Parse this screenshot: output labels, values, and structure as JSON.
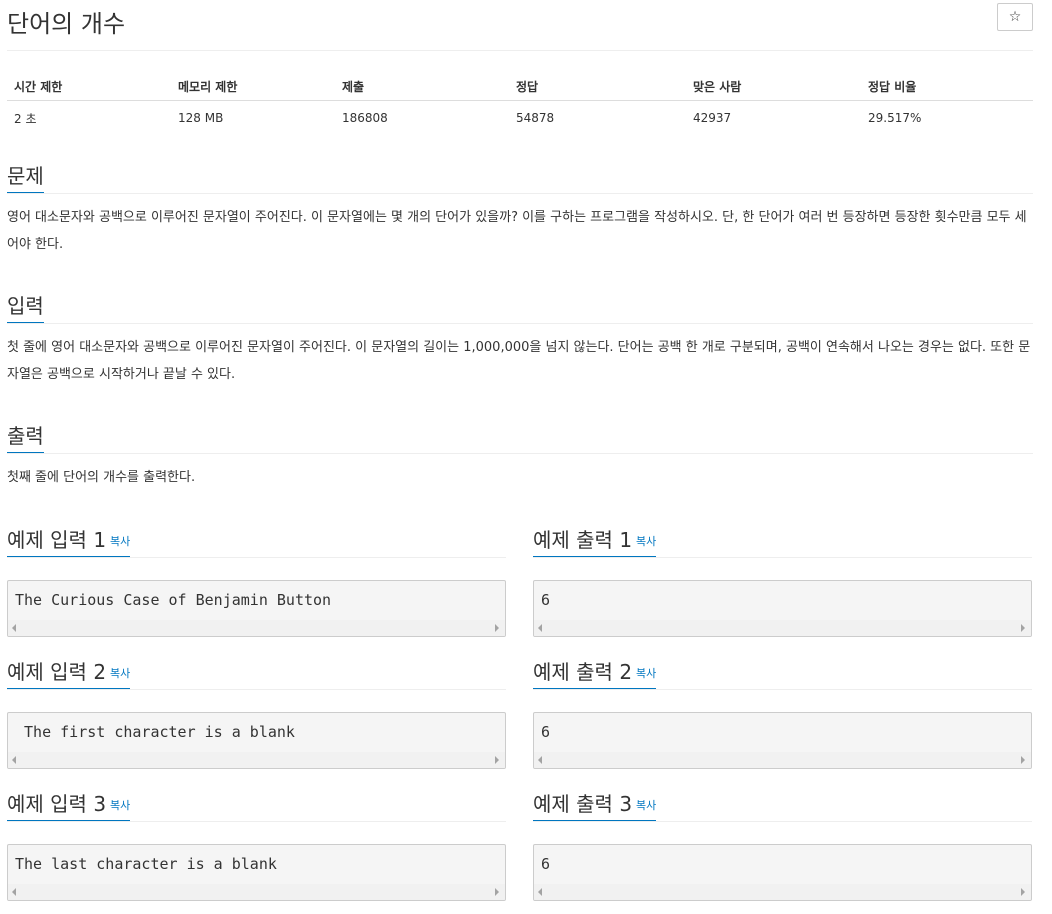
{
  "problem": {
    "title": "단어의 개수",
    "star_icon": "☆"
  },
  "info": {
    "headers": [
      "시간 제한",
      "메모리 제한",
      "제출",
      "정답",
      "맞은 사람",
      "정답 비율"
    ],
    "values": [
      "2 초",
      "128 MB",
      "186808",
      "54878",
      "42937",
      "29.517%"
    ]
  },
  "sections": {
    "description": {
      "title": "문제",
      "text": "영어 대소문자와 공백으로 이루어진 문자열이 주어진다. 이 문자열에는 몇 개의 단어가 있을까? 이를 구하는 프로그램을 작성하시오. 단, 한 단어가 여러 번 등장하면 등장한 횟수만큼 모두 세어야 한다."
    },
    "input": {
      "title": "입력",
      "text": "첫 줄에 영어 대소문자와 공백으로 이루어진 문자열이 주어진다. 이 문자열의 길이는 1,000,000을 넘지 않는다. 단어는 공백 한 개로 구분되며, 공백이 연속해서 나오는 경우는 없다. 또한 문자열은 공백으로 시작하거나 끝날 수 있다."
    },
    "output": {
      "title": "출력",
      "text": "첫째 줄에 단어의 개수를 출력한다."
    }
  },
  "samples": {
    "copy_label": "복사",
    "input_1": {
      "title": "예제 입력 1",
      "text": "The Curious Case of Benjamin Button"
    },
    "output_1": {
      "title": "예제 출력 1",
      "text": "6"
    },
    "input_2": {
      "title": "예제 입력 2",
      "text": " The first character is a blank"
    },
    "output_2": {
      "title": "예제 출력 2",
      "text": "6"
    },
    "input_3": {
      "title": "예제 입력 3",
      "text": "The last character is a blank "
    },
    "output_3": {
      "title": "예제 출력 3",
      "text": "6"
    }
  }
}
